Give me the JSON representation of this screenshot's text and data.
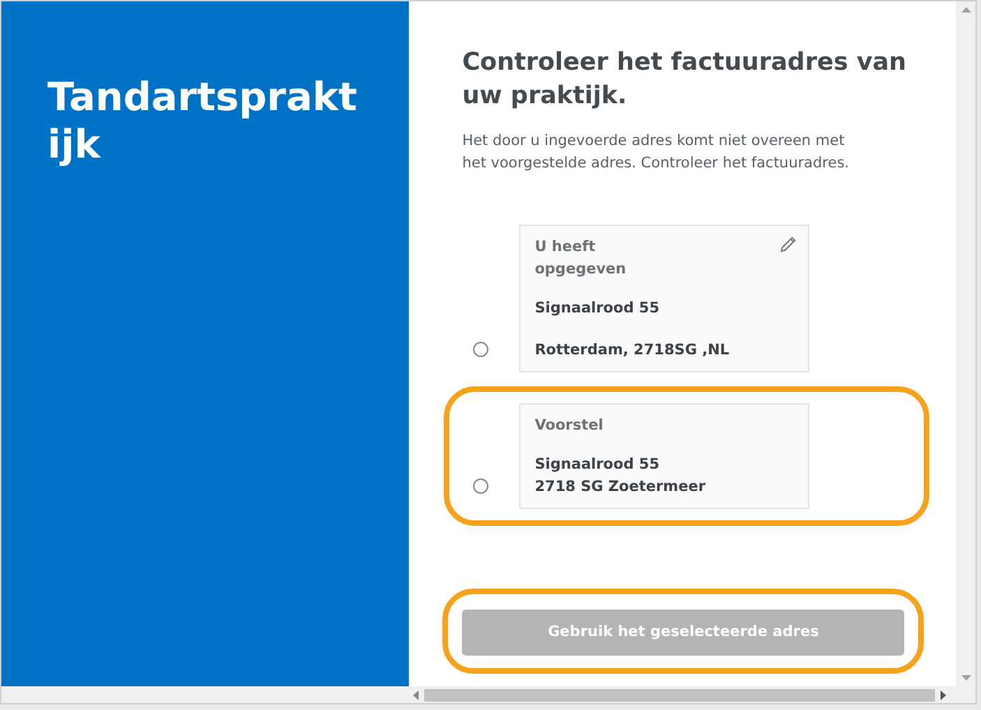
{
  "sidebar": {
    "title": "Tandartsprakt ijk"
  },
  "main": {
    "heading": "Controleer het factuuradres van uw praktijk.",
    "description": "Het door u ingevoerde adres komt niet overeen met het voorgestelde adres. Controleer het factuuradres.",
    "options": [
      {
        "kind": "entered",
        "selected": false,
        "highlighted": false,
        "title": "U heeft opgegeven",
        "lines": [
          "Signaalrood 55",
          "Rotterdam, 2718SG ,NL"
        ]
      },
      {
        "kind": "suggestion",
        "selected": false,
        "highlighted": true,
        "title": "Voorstel",
        "lines": [
          "Signaalrood 55",
          "2718 SG Zoetermeer"
        ]
      }
    ],
    "button": {
      "label": "Gebruik het geselecteerde adres",
      "disabled": true,
      "highlighted": true
    }
  }
}
